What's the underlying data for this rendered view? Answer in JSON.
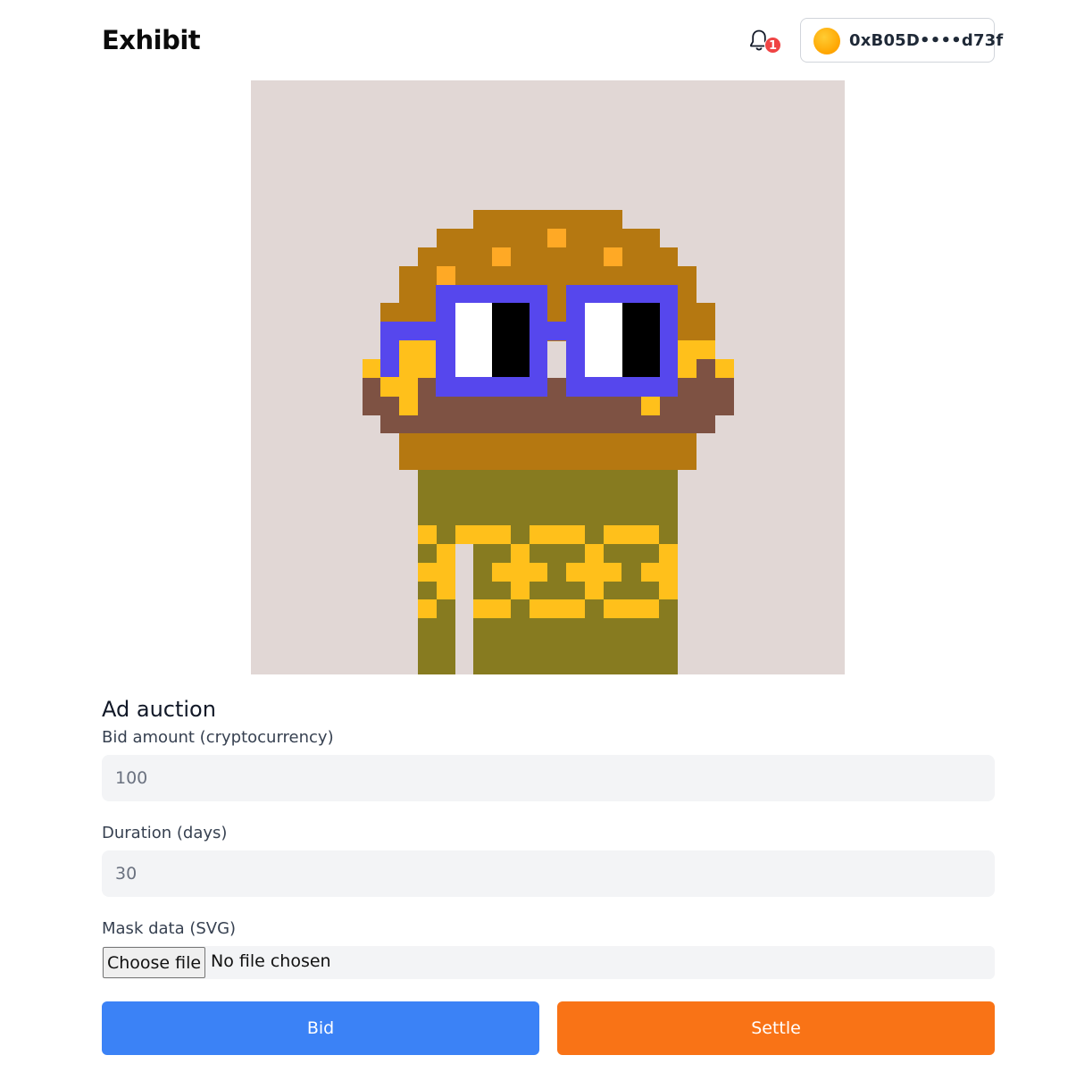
{
  "header": {
    "brand": "Exhibit",
    "notifications": {
      "count": "1",
      "icon": "bell-icon"
    },
    "wallet": {
      "address": "0xB05D••••d73f",
      "avatar_color": "#ffa500"
    }
  },
  "artwork": {
    "background": "#e1d7d5",
    "palette": {
      "hat": "#b57811",
      "hat_spot": "#ffa925",
      "glasses": "#5647ed",
      "eye_white": "#ffffff",
      "eye_black": "#000000",
      "yellow": "#ffc01b",
      "skin": "#7e5243",
      "body": "#877b20"
    }
  },
  "form": {
    "title": "Ad auction",
    "bid": {
      "label": "Bid amount (cryptocurrency)",
      "placeholder": "100"
    },
    "duration": {
      "label": "Duration (days)",
      "placeholder": "30"
    },
    "mask": {
      "label": "Mask data (SVG)",
      "button": "Choose file",
      "status": "No file chosen"
    }
  },
  "actions": {
    "bid": {
      "label": "Bid",
      "color": "#3b82f6"
    },
    "settle": {
      "label": "Settle",
      "color": "#f97316"
    }
  }
}
